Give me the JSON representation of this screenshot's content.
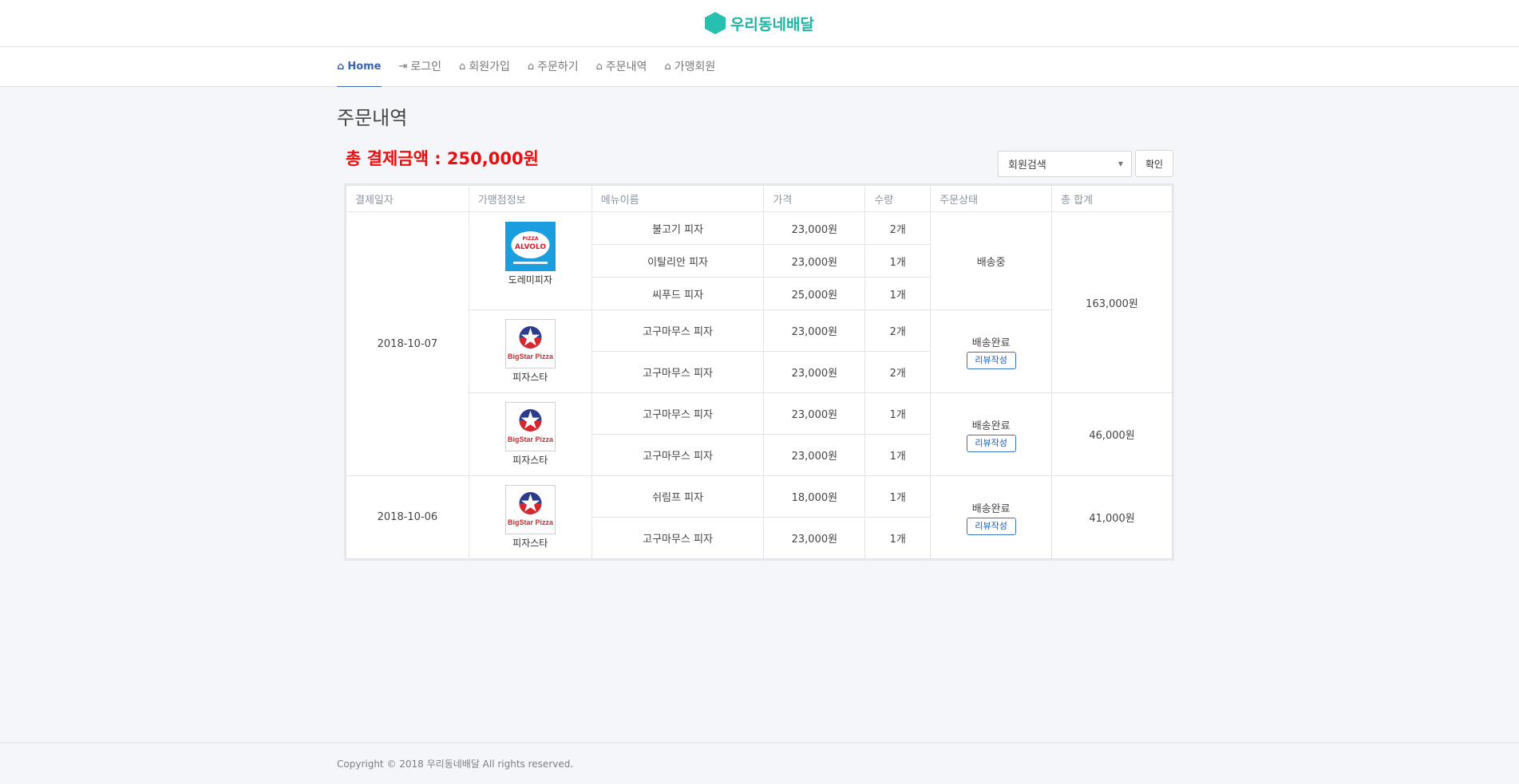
{
  "header": {
    "brand": "우리동네배달",
    "brand_icon": "hexagon-logo-icon",
    "brand_color": "#1fb5a5"
  },
  "nav": [
    {
      "label": "Home",
      "icon": "home-icon",
      "glyph": "⌂",
      "active": true
    },
    {
      "label": "로그인",
      "icon": "login-icon",
      "glyph": "⇥"
    },
    {
      "label": "회원가입",
      "icon": "home-icon",
      "glyph": "⌂"
    },
    {
      "label": "주문하기",
      "icon": "home-icon",
      "glyph": "⌂"
    },
    {
      "label": "주문내역",
      "icon": "home-icon",
      "glyph": "⌂"
    },
    {
      "label": "가맹회원",
      "icon": "home-icon",
      "glyph": "⌂"
    }
  ],
  "page": {
    "title": "주문내역",
    "total_label": "총 결제금액 : 250,000원",
    "total_color": "#ee0d0d"
  },
  "search": {
    "selected": "회원검색",
    "confirm_label": "확인"
  },
  "table": {
    "headers": [
      "결제일자",
      "가맹점정보",
      "메뉴이름",
      "가격",
      "수량",
      "주문상태",
      "총 합계"
    ],
    "review_label": "리뷰작성",
    "dates": [
      "2018-10-07",
      "2018-10-06"
    ],
    "orders": [
      {
        "store": "도레미피자",
        "store_logo": "alvolo-pizza-logo",
        "items": [
          {
            "menu": "불고기 피자",
            "price": "23,000원",
            "qty": "2개"
          },
          {
            "menu": "이탈리안 피자",
            "price": "23,000원",
            "qty": "1개"
          },
          {
            "menu": "씨푸드 피자",
            "price": "25,000원",
            "qty": "1개"
          }
        ],
        "status": "배송중",
        "total": "163,000원"
      },
      {
        "store": "피자스타",
        "store_logo": "bigstar-pizza-logo",
        "items": [
          {
            "menu": "고구마무스 피자",
            "price": "23,000원",
            "qty": "2개"
          },
          {
            "menu": "고구마무스 피자",
            "price": "23,000원",
            "qty": "2개"
          }
        ],
        "status": "배송완료"
      },
      {
        "store": "피자스타",
        "store_logo": "bigstar-pizza-logo",
        "items": [
          {
            "menu": "고구마무스 피자",
            "price": "23,000원",
            "qty": "1개"
          },
          {
            "menu": "고구마무스 피자",
            "price": "23,000원",
            "qty": "1개"
          }
        ],
        "status": "배송완료",
        "total": "46,000원"
      },
      {
        "store": "피자스타",
        "store_logo": "bigstar-pizza-logo",
        "items": [
          {
            "menu": "쉬림프 피자",
            "price": "18,000원",
            "qty": "1개"
          },
          {
            "menu": "고구마무스 피자",
            "price": "23,000원",
            "qty": "1개"
          }
        ],
        "status": "배송완료",
        "total": "41,000원"
      }
    ]
  },
  "logos": {
    "alvolo": {
      "top": "PIZZA",
      "main": "ALVOLO"
    },
    "bigstar": {
      "main": "BigStar Pizza"
    }
  },
  "footer": {
    "text": "Copyright © 2018 우리동네배달 All rights reserved."
  }
}
